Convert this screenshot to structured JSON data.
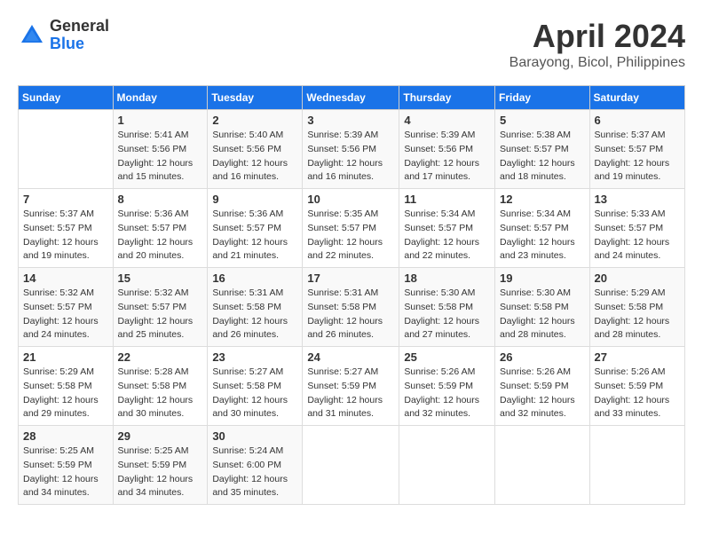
{
  "logo": {
    "general": "General",
    "blue": "Blue"
  },
  "title": "April 2024",
  "subtitle": "Barayong, Bicol, Philippines",
  "weekdays": [
    "Sunday",
    "Monday",
    "Tuesday",
    "Wednesday",
    "Thursday",
    "Friday",
    "Saturday"
  ],
  "weeks": [
    [
      {
        "day": "",
        "sunrise": "",
        "sunset": "",
        "daylight": ""
      },
      {
        "day": "1",
        "sunrise": "Sunrise: 5:41 AM",
        "sunset": "Sunset: 5:56 PM",
        "daylight": "Daylight: 12 hours and 15 minutes."
      },
      {
        "day": "2",
        "sunrise": "Sunrise: 5:40 AM",
        "sunset": "Sunset: 5:56 PM",
        "daylight": "Daylight: 12 hours and 16 minutes."
      },
      {
        "day": "3",
        "sunrise": "Sunrise: 5:39 AM",
        "sunset": "Sunset: 5:56 PM",
        "daylight": "Daylight: 12 hours and 16 minutes."
      },
      {
        "day": "4",
        "sunrise": "Sunrise: 5:39 AM",
        "sunset": "Sunset: 5:56 PM",
        "daylight": "Daylight: 12 hours and 17 minutes."
      },
      {
        "day": "5",
        "sunrise": "Sunrise: 5:38 AM",
        "sunset": "Sunset: 5:57 PM",
        "daylight": "Daylight: 12 hours and 18 minutes."
      },
      {
        "day": "6",
        "sunrise": "Sunrise: 5:37 AM",
        "sunset": "Sunset: 5:57 PM",
        "daylight": "Daylight: 12 hours and 19 minutes."
      }
    ],
    [
      {
        "day": "7",
        "sunrise": "Sunrise: 5:37 AM",
        "sunset": "Sunset: 5:57 PM",
        "daylight": "Daylight: 12 hours and 19 minutes."
      },
      {
        "day": "8",
        "sunrise": "Sunrise: 5:36 AM",
        "sunset": "Sunset: 5:57 PM",
        "daylight": "Daylight: 12 hours and 20 minutes."
      },
      {
        "day": "9",
        "sunrise": "Sunrise: 5:36 AM",
        "sunset": "Sunset: 5:57 PM",
        "daylight": "Daylight: 12 hours and 21 minutes."
      },
      {
        "day": "10",
        "sunrise": "Sunrise: 5:35 AM",
        "sunset": "Sunset: 5:57 PM",
        "daylight": "Daylight: 12 hours and 22 minutes."
      },
      {
        "day": "11",
        "sunrise": "Sunrise: 5:34 AM",
        "sunset": "Sunset: 5:57 PM",
        "daylight": "Daylight: 12 hours and 22 minutes."
      },
      {
        "day": "12",
        "sunrise": "Sunrise: 5:34 AM",
        "sunset": "Sunset: 5:57 PM",
        "daylight": "Daylight: 12 hours and 23 minutes."
      },
      {
        "day": "13",
        "sunrise": "Sunrise: 5:33 AM",
        "sunset": "Sunset: 5:57 PM",
        "daylight": "Daylight: 12 hours and 24 minutes."
      }
    ],
    [
      {
        "day": "14",
        "sunrise": "Sunrise: 5:32 AM",
        "sunset": "Sunset: 5:57 PM",
        "daylight": "Daylight: 12 hours and 24 minutes."
      },
      {
        "day": "15",
        "sunrise": "Sunrise: 5:32 AM",
        "sunset": "Sunset: 5:57 PM",
        "daylight": "Daylight: 12 hours and 25 minutes."
      },
      {
        "day": "16",
        "sunrise": "Sunrise: 5:31 AM",
        "sunset": "Sunset: 5:58 PM",
        "daylight": "Daylight: 12 hours and 26 minutes."
      },
      {
        "day": "17",
        "sunrise": "Sunrise: 5:31 AM",
        "sunset": "Sunset: 5:58 PM",
        "daylight": "Daylight: 12 hours and 26 minutes."
      },
      {
        "day": "18",
        "sunrise": "Sunrise: 5:30 AM",
        "sunset": "Sunset: 5:58 PM",
        "daylight": "Daylight: 12 hours and 27 minutes."
      },
      {
        "day": "19",
        "sunrise": "Sunrise: 5:30 AM",
        "sunset": "Sunset: 5:58 PM",
        "daylight": "Daylight: 12 hours and 28 minutes."
      },
      {
        "day": "20",
        "sunrise": "Sunrise: 5:29 AM",
        "sunset": "Sunset: 5:58 PM",
        "daylight": "Daylight: 12 hours and 28 minutes."
      }
    ],
    [
      {
        "day": "21",
        "sunrise": "Sunrise: 5:29 AM",
        "sunset": "Sunset: 5:58 PM",
        "daylight": "Daylight: 12 hours and 29 minutes."
      },
      {
        "day": "22",
        "sunrise": "Sunrise: 5:28 AM",
        "sunset": "Sunset: 5:58 PM",
        "daylight": "Daylight: 12 hours and 30 minutes."
      },
      {
        "day": "23",
        "sunrise": "Sunrise: 5:27 AM",
        "sunset": "Sunset: 5:58 PM",
        "daylight": "Daylight: 12 hours and 30 minutes."
      },
      {
        "day": "24",
        "sunrise": "Sunrise: 5:27 AM",
        "sunset": "Sunset: 5:59 PM",
        "daylight": "Daylight: 12 hours and 31 minutes."
      },
      {
        "day": "25",
        "sunrise": "Sunrise: 5:26 AM",
        "sunset": "Sunset: 5:59 PM",
        "daylight": "Daylight: 12 hours and 32 minutes."
      },
      {
        "day": "26",
        "sunrise": "Sunrise: 5:26 AM",
        "sunset": "Sunset: 5:59 PM",
        "daylight": "Daylight: 12 hours and 32 minutes."
      },
      {
        "day": "27",
        "sunrise": "Sunrise: 5:26 AM",
        "sunset": "Sunset: 5:59 PM",
        "daylight": "Daylight: 12 hours and 33 minutes."
      }
    ],
    [
      {
        "day": "28",
        "sunrise": "Sunrise: 5:25 AM",
        "sunset": "Sunset: 5:59 PM",
        "daylight": "Daylight: 12 hours and 34 minutes."
      },
      {
        "day": "29",
        "sunrise": "Sunrise: 5:25 AM",
        "sunset": "Sunset: 5:59 PM",
        "daylight": "Daylight: 12 hours and 34 minutes."
      },
      {
        "day": "30",
        "sunrise": "Sunrise: 5:24 AM",
        "sunset": "Sunset: 6:00 PM",
        "daylight": "Daylight: 12 hours and 35 minutes."
      },
      {
        "day": "",
        "sunrise": "",
        "sunset": "",
        "daylight": ""
      },
      {
        "day": "",
        "sunrise": "",
        "sunset": "",
        "daylight": ""
      },
      {
        "day": "",
        "sunrise": "",
        "sunset": "",
        "daylight": ""
      },
      {
        "day": "",
        "sunrise": "",
        "sunset": "",
        "daylight": ""
      }
    ]
  ]
}
